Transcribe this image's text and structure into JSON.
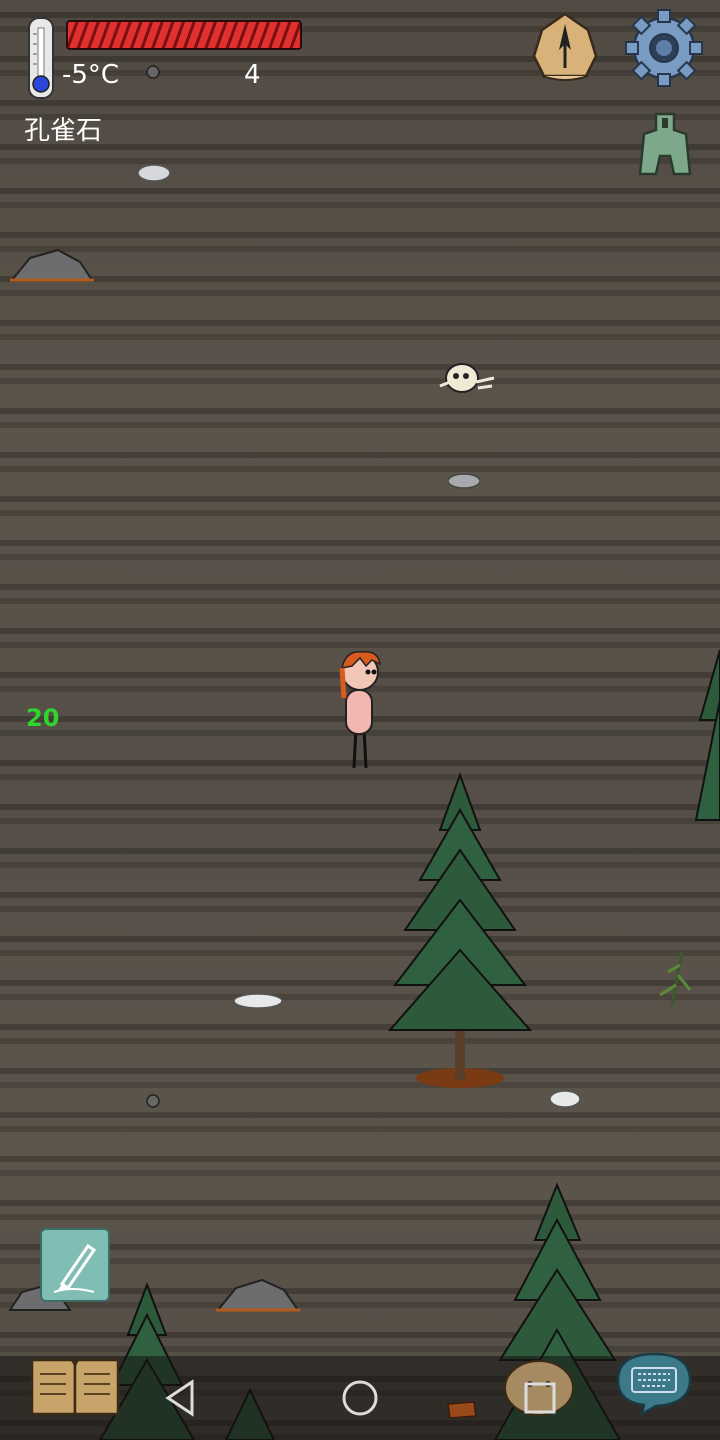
{
  "hud": {
    "temperature": "-5°C",
    "count": "4",
    "held_item": "孔雀石",
    "food_value": "20",
    "health_segments": 20
  },
  "icons": {
    "thermometer": "thermometer-icon",
    "compass": "compass-icon",
    "settings": "gear-icon",
    "relic": "spade-coin-icon",
    "pencil": "pencil-icon",
    "journal": "book-icon",
    "chat": "keyboard-bubble-icon",
    "emote": "face-icon"
  },
  "colors": {
    "health": "#d42a2a",
    "food": "#2fd42f",
    "tree": "#2d5a3a",
    "ground": "#4e4840"
  }
}
